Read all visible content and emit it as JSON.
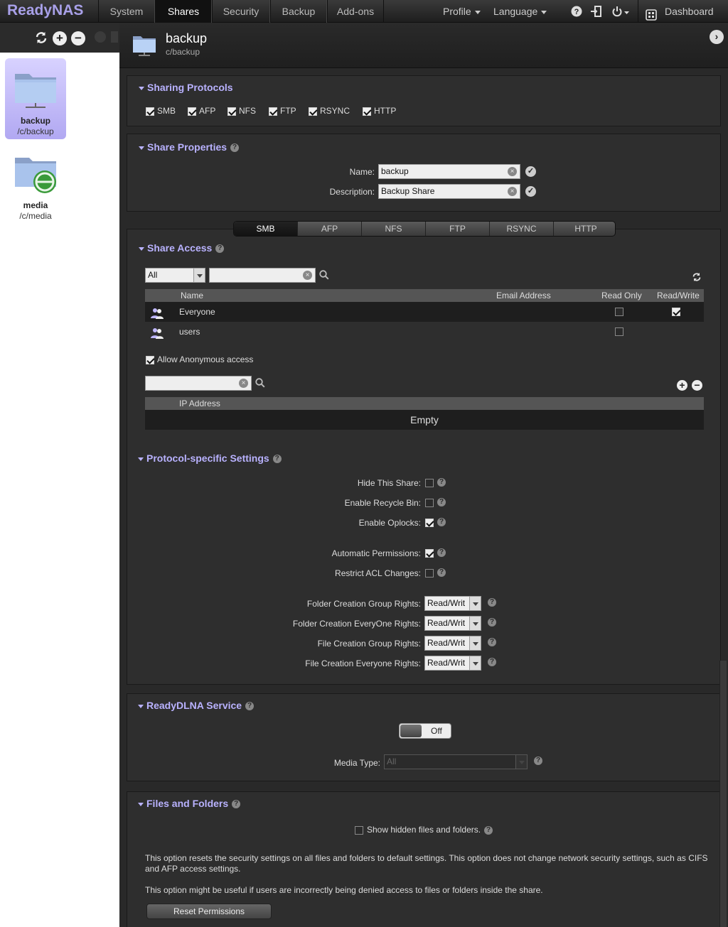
{
  "app": {
    "brand": "ReadyNAS"
  },
  "nav": {
    "tabs": [
      "System",
      "Shares",
      "Security",
      "Backup",
      "Add-ons"
    ],
    "active": "Shares",
    "profile": "Profile",
    "language": "Language",
    "dashboard": "Dashboard"
  },
  "sidebar": {
    "shares": [
      {
        "name": "backup",
        "path": "/c/backup",
        "selected": true
      },
      {
        "name": "media",
        "path": "/c/media",
        "selected": false
      }
    ]
  },
  "header": {
    "title": "backup",
    "path": "c/backup"
  },
  "sharing_protocols": {
    "title": "Sharing Protocols",
    "items": [
      {
        "label": "SMB",
        "checked": true
      },
      {
        "label": "AFP",
        "checked": true
      },
      {
        "label": "NFS",
        "checked": true
      },
      {
        "label": "FTP",
        "checked": true
      },
      {
        "label": "RSYNC",
        "checked": true
      },
      {
        "label": "HTTP",
        "checked": true
      }
    ]
  },
  "share_properties": {
    "title": "Share Properties",
    "name_label": "Name:",
    "name_value": "backup",
    "desc_label": "Description:",
    "desc_value": "Backup Share"
  },
  "protocol_tabs": [
    "SMB",
    "AFP",
    "NFS",
    "FTP",
    "RSYNC",
    "HTTP"
  ],
  "share_access": {
    "title": "Share Access",
    "filter_value": "All",
    "columns": {
      "name": "Name",
      "email": "Email Address",
      "read_only": "Read Only",
      "read_write": "Read/Write"
    },
    "rows": [
      {
        "name": "Everyone",
        "read_only": false,
        "read_write": true
      },
      {
        "name": "users",
        "read_only": false,
        "read_write": null
      }
    ],
    "anonymous_label": "Allow Anonymous access",
    "anonymous_checked": true,
    "ip_column": "IP Address",
    "ip_empty": "Empty"
  },
  "protocol_settings": {
    "title": "Protocol-specific Settings",
    "checks": [
      {
        "label": "Hide This Share:",
        "checked": false
      },
      {
        "label": "Enable Recycle Bin:",
        "checked": false
      },
      {
        "label": "Enable Oplocks:",
        "checked": true
      },
      {
        "label": "Automatic Permissions:",
        "checked": true
      },
      {
        "label": "Restrict ACL Changes:",
        "checked": false
      }
    ],
    "rights": [
      {
        "label": "Folder Creation Group Rights:",
        "value": "Read/Writ"
      },
      {
        "label": "Folder Creation EveryOne Rights:",
        "value": "Read/Writ"
      },
      {
        "label": "File Creation Group Rights:",
        "value": "Read/Writ"
      },
      {
        "label": "File Creation Everyone Rights:",
        "value": "Read/Writ"
      }
    ]
  },
  "readydlna": {
    "title": "ReadyDLNA Service",
    "toggle": "Off",
    "media_type_label": "Media Type:",
    "media_type_value": "All"
  },
  "files_folders": {
    "title": "Files and Folders",
    "show_hidden_label": "Show hidden files and folders.",
    "show_hidden_checked": false,
    "para1": "This option resets the security settings on all files and folders to default settings. This option does not change network security settings, such as CIFS and AFP access settings.",
    "para2": "This option might be useful if users are incorrectly being denied access to files or folders inside the share.",
    "reset_button": "Reset Permissions"
  }
}
